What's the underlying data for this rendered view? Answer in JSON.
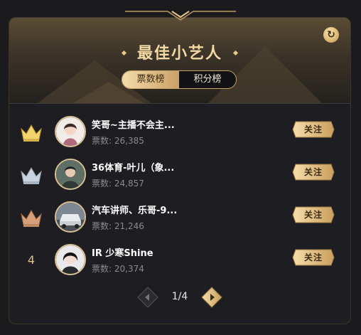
{
  "header": {
    "title": "最佳小艺人",
    "refresh_icon": "refresh-icon",
    "tabs": [
      {
        "label": "票数榜",
        "active": true
      },
      {
        "label": "积分榜",
        "active": false
      }
    ]
  },
  "list": [
    {
      "rank": "",
      "rank_icon": "gold-crown-icon",
      "name": "笑哥~主播不会主...",
      "votes": "票数: 26,385",
      "follow_label": "关注"
    },
    {
      "rank": "",
      "rank_icon": "silver-crown-icon",
      "name": "36体育-叶儿（象...",
      "votes": "票数: 24,857",
      "follow_label": "关注"
    },
    {
      "rank": "",
      "rank_icon": "bronze-crown-icon",
      "name": "汽车讲师、乐哥-9...",
      "votes": "票数: 21,246",
      "follow_label": "关注"
    },
    {
      "rank": "4",
      "rank_icon": "",
      "name": "IR 少寒Shine",
      "votes": "票数: 20,374",
      "follow_label": "关注"
    }
  ],
  "pager": {
    "text": "1/4"
  },
  "colors": {
    "gold": "#e8c98a",
    "crown_gold": "#f2d26a",
    "crown_silver": "#c9d3de",
    "crown_bronze": "#d8a07a",
    "panel": "#1e1e22"
  }
}
